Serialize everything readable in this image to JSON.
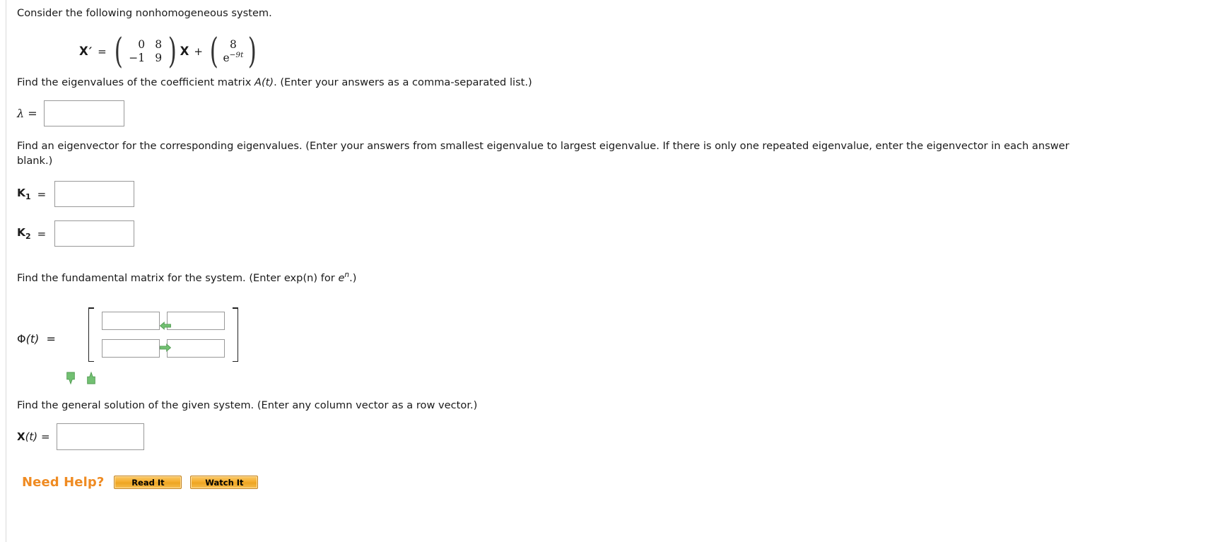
{
  "problem": {
    "intro": "Consider the following nonhomogeneous system.",
    "equation": {
      "lhs_symbol": "X",
      "lhs_prime": "′",
      "equals": "=",
      "coefficient_matrix": [
        [
          "0",
          "8"
        ],
        [
          "−1",
          "9"
        ]
      ],
      "times_vector": "X",
      "plus": "+",
      "forcing_vector_row1": "8",
      "forcing_vector_row2_base": "e",
      "forcing_vector_row2_exponent": "−9t",
      "paren_left": "(",
      "paren_right": ")"
    }
  },
  "part1": {
    "prompt": "Find the eigenvalues of the coefficient matrix A(t). (Enter your answers as a comma-separated list.)",
    "prompt_pre": "Find the eigenvalues of the coefficient matrix ",
    "prompt_var": "A",
    "prompt_var_arg": "(t)",
    "prompt_post": ". (Enter your answers as a comma-separated list.)",
    "label": "λ  =",
    "input_value": "",
    "input_placeholder": ""
  },
  "part2": {
    "prompt_line1": "Find an eigenvector for the corresponding eigenvalues. (Enter your answers from smallest eigenvalue to largest eigenvalue. If there is only one repeated eigenvalue, enter the eigenvector in each answer",
    "prompt_line2": "blank.)",
    "k1_label": "K",
    "k1_sub": "1",
    "k2_label": "K",
    "k2_sub": "2",
    "equals": "=",
    "k1_value": "",
    "k2_value": ""
  },
  "part3": {
    "prompt_pre": "Find the fundamental matrix for the system. (Enter exp(n) for ",
    "prompt_e": "e",
    "prompt_exp": "n",
    "prompt_post": ".)",
    "phi_label_symbol": "Φ",
    "phi_label_arg": "(t)",
    "phi_label_equals": "=",
    "cells": [
      "",
      "",
      "",
      ""
    ],
    "arrow_left_icon": "arrow-left-icon",
    "arrow_right_icon": "arrow-right-icon",
    "arrow_down_icon": "arrow-down-icon",
    "arrow_up_icon": "arrow-up-icon",
    "arrow_color": "#6dbf6d"
  },
  "part4": {
    "prompt": "Find the general solution of the given system. (Enter any column vector as a row vector.)",
    "label_symbol": "X",
    "label_arg": "(t)",
    "label_equals": "=",
    "input_value": ""
  },
  "help": {
    "title": "Need Help?",
    "read_label": "Read It",
    "watch_label": "Watch It",
    "accent_color": "#ef8b22"
  }
}
